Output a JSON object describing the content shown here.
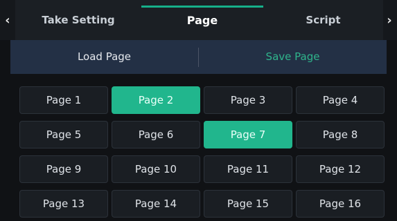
{
  "tabs": {
    "prev_icon": "chevron-left-icon",
    "next_icon": "chevron-right-icon",
    "prev_glyph": "‹",
    "next_glyph": "›",
    "items": [
      {
        "label": "Take Setting"
      },
      {
        "label": "Page"
      },
      {
        "label": "Script"
      }
    ],
    "active_index": 1
  },
  "segment": {
    "load_label": "Load Page",
    "save_label": "Save Page",
    "active": "save"
  },
  "pages": {
    "items": [
      {
        "label": "Page 1",
        "selected": false
      },
      {
        "label": "Page 2",
        "selected": true
      },
      {
        "label": "Page 3",
        "selected": false
      },
      {
        "label": "Page 4",
        "selected": false
      },
      {
        "label": "Page 5",
        "selected": false
      },
      {
        "label": "Page 6",
        "selected": false
      },
      {
        "label": "Page 7",
        "selected": true
      },
      {
        "label": "Page 8",
        "selected": false
      },
      {
        "label": "Page 9",
        "selected": false
      },
      {
        "label": "Page 10",
        "selected": false
      },
      {
        "label": "Page 11",
        "selected": false
      },
      {
        "label": "Page 12",
        "selected": false
      },
      {
        "label": "Page 13",
        "selected": false
      },
      {
        "label": "Page 14",
        "selected": false
      },
      {
        "label": "Page 15",
        "selected": false
      },
      {
        "label": "Page 16",
        "selected": false
      }
    ]
  },
  "colors": {
    "accent": "#21b68d",
    "save_text": "#2fb58c",
    "segment_bg": "#233045",
    "background": "#101215"
  }
}
